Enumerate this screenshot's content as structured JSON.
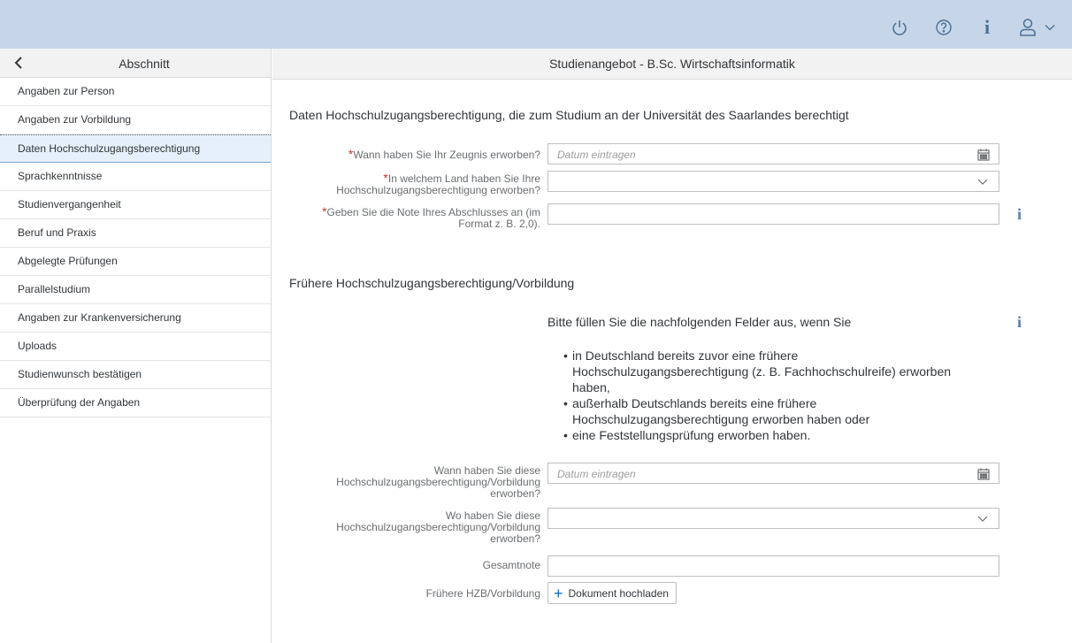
{
  "topbar": {
    "icons": [
      "power-icon",
      "help-icon",
      "info-icon",
      "user-icon",
      "chevron-down-icon"
    ]
  },
  "sidebar": {
    "title": "Abschnitt",
    "items": [
      {
        "label": "Angaben zur Person"
      },
      {
        "label": "Angaben zur Vorbildung"
      },
      {
        "label": "Daten Hochschulzugangsberechtigung",
        "selected": true
      },
      {
        "label": "Sprachkenntnisse"
      },
      {
        "label": "Studienvergangenheit"
      },
      {
        "label": "Beruf und Praxis"
      },
      {
        "label": "Abgelegte Prüfungen"
      },
      {
        "label": "Parallelstudium"
      },
      {
        "label": "Angaben zur Krankenversicherung"
      },
      {
        "label": "Uploads"
      },
      {
        "label": "Studienwunsch bestätigen"
      },
      {
        "label": "Überprüfung der Angaben"
      }
    ]
  },
  "main": {
    "header": "Studienangebot - B.Sc. Wirtschaftsinformatik",
    "section1": {
      "title": "Daten Hochschulzugangsberechtigung, die zum Studium an der Universität des Saarlandes berechtigt",
      "f1": {
        "label": "Wann haben Sie Ihr Zeugnis erworben?",
        "placeholder": "Datum eintragen",
        "required": true
      },
      "f2": {
        "label_line1": "In welchem Land haben Sie Ihre",
        "label_line2": "Hochschulzugangsberechtigung erworben?",
        "value": "",
        "required": true
      },
      "f3": {
        "label_line1": "Geben Sie die Note Ihres Abschlusses an (im",
        "label_line2": "Format z. B. 2,0).",
        "value": "",
        "required": true
      },
      "required_mark": "*"
    },
    "section2": {
      "title": "Frühere Hochschulzugangsberechtigung/Vorbildung",
      "intro": "Bitte füllen Sie die nachfolgenden Felder aus, wenn Sie",
      "bullets": [
        {
          "l1": "in Deutschland bereits zuvor eine frühere",
          "l2": "Hochschulzugangsberechtigung (z. B. Fachhochschulreife) erworben",
          "l3": "haben,"
        },
        {
          "l1": "außerhalb Deutschlands bereits eine frühere",
          "l2": "Hochschulzugangsberechtigung erworben haben oder"
        },
        {
          "l1": "eine Feststellungsprüfung erworben haben."
        }
      ],
      "f4": {
        "label_line1": "Wann haben Sie diese",
        "label_line2": "Hochschulzugangsberechtigung/Vorbildung",
        "label_line3": "erworben?",
        "placeholder": "Datum eintragen"
      },
      "f5": {
        "label_line1": "Wo haben Sie diese",
        "label_line2": "Hochschulzugangsberechtigung/Vorbildung",
        "label_line3": "erworben?",
        "value": ""
      },
      "f6": {
        "label": "Gesamtnote",
        "value": ""
      },
      "f7": {
        "label": "Frühere HZB/Vorbildung",
        "button": "Dokument hochladen"
      }
    }
  },
  "colors": {
    "topbar": "#c6d6e8",
    "required": "#c0392b",
    "accent": "#0a6ed1",
    "selected_row": "#e5f0fa"
  }
}
